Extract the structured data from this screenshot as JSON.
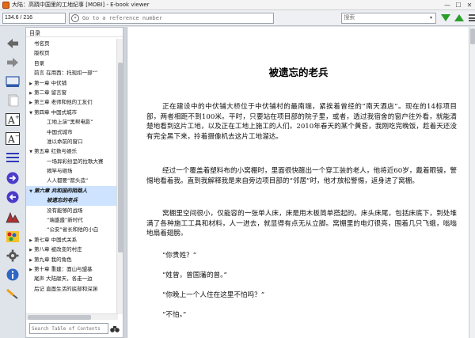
{
  "window": {
    "title": "大陆：高跷中国里的工地纪事 [MOBI] - E-book viewer",
    "minimize": "—",
    "maximize": "☐",
    "close": "✕"
  },
  "toolbar": {
    "position_value": "134.6 / 216",
    "goto_placeholder": "Go to a reference number",
    "search_placeholder": "搜索",
    "dropdown_glyph": "▾"
  },
  "toc": {
    "header": "目录",
    "items": [
      {
        "label": "书名页",
        "arrow": ""
      },
      {
        "label": "版权页",
        "arrow": ""
      },
      {
        "label": "目录",
        "arrow": ""
      },
      {
        "label": "前言 在用西：托现扣一部“”",
        "arrow": ""
      },
      {
        "label": "第一章 中伏铺",
        "arrow": "▶"
      },
      {
        "label": "第二章 留言窗",
        "arrow": "▶"
      },
      {
        "label": "第三章 老师和他的工友们",
        "arrow": "▶"
      },
      {
        "label": "第四章 中国式城市",
        "arrow": "▼"
      },
      {
        "label": "工地上演“黑帮电影”",
        "arrow": "",
        "indent": true
      },
      {
        "label": "中国式城市",
        "arrow": "",
        "indent": true
      },
      {
        "label": "淮以命前的窗口",
        "arrow": "",
        "indent": true
      },
      {
        "label": "第五章 红数与娱乐",
        "arrow": "▼"
      },
      {
        "label": "一场异彩纷呈的拉歌大赛",
        "arrow": "",
        "indent": true
      },
      {
        "label": "揭竿与砸场",
        "arrow": "",
        "indent": true
      },
      {
        "label": "人人都要“箭头造”",
        "arrow": "",
        "indent": true
      },
      {
        "label": "第六章 共和国的陌路人",
        "arrow": "▼",
        "selected": true
      },
      {
        "label": "被遗忘的老兵",
        "arrow": "",
        "indent": true,
        "selected": true
      },
      {
        "label": "没有能够的战场",
        "arrow": "",
        "indent": true
      },
      {
        "label": "“端盛盛”新时代",
        "arrow": "",
        "indent": true
      },
      {
        "label": "“公安”省长和他的小白",
        "arrow": "",
        "indent": true
      },
      {
        "label": "第七章 中国式关系",
        "arrow": "▶"
      },
      {
        "label": "第八章 被改变的村庄",
        "arrow": "▶"
      },
      {
        "label": "第九章 我的角色",
        "arrow": "▶"
      },
      {
        "label": "第十章 重建：面山与盟基",
        "arrow": "▶"
      },
      {
        "label": "尾声 大陆献天，各走一边",
        "arrow": ""
      },
      {
        "label": "后记 直面生活的底部和深渊",
        "arrow": ""
      }
    ],
    "search_placeholder": "Search Table of Contents"
  },
  "reader": {
    "chapter_title": "被遗忘的老兵",
    "paragraphs": [
      "正在建设中的中伏铺大桥位于中伏铺村的最南端，紧挨着曾经的“南天酒店”。现在的14标项目部，两者相距不到100米。平时，只要站在项目部的院子里，或者，透过我宿舍的窗户往外看，就能清楚地看到这片工地，以及正在工地上施工的人们。2010年春天的某个黄昏，我刚吃完晚饭，趁着天还没有完全黑下来，拎着摄像机去这片工地溜达。",
      "经过一个覆盖着塑料布的小窝棚时，里面很快踱出一个穿工装的老人，他将近60岁，戴着眼镜，警惕地看着我。直到我解释我是来自旁边项目部的“邻居”时，他才放松警惕，返身进了窝棚。",
      "窝棚里空间很小，仅能容的一张单人床，床是用木板简单搭起的。床头床尾，包括床底下，到处堆满了各种施工工具和材料，人一进去，就显得有点无从立脚。窝棚里的电灯很亮，围着几只飞蛾，嗡嗡地扇着翅膀。",
      "“你贵姓？”",
      "“姓曾，曾国藩的曾。”",
      "“你晚上一个人住在这里不怕吗？”",
      "“不怕。”"
    ]
  },
  "icons": {
    "left_toolbar": [
      "back-arrow-icon",
      "forward-arrow-icon",
      "library-icon",
      "copy-icon",
      "font-larger-icon",
      "font-smaller-icon",
      "toc-icon",
      "next-chapter-icon",
      "previous-chapter-icon",
      "reference-mode-icon",
      "themes-icon",
      "preferences-icon",
      "info-icon",
      "print-icon"
    ]
  },
  "colors": {
    "accent_green": "#2a9e2a",
    "toc_selected_bg": "#cde3ff",
    "nav_blue": "#4a3cc8"
  }
}
